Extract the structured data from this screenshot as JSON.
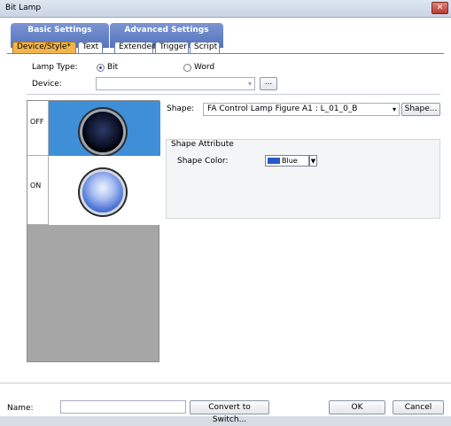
{
  "window": {
    "title": "Bit Lamp",
    "close_glyph": "✕"
  },
  "tabs": {
    "groups": [
      {
        "label": "Basic Settings"
      },
      {
        "label": "Advanced Settings"
      }
    ],
    "subtabs": [
      "Device/Style*",
      "Text",
      "Extended",
      "Trigger",
      "Script"
    ],
    "active_subtab": "Device/Style*"
  },
  "lamp_type": {
    "label": "Lamp Type:",
    "options": [
      {
        "label": "Bit",
        "checked": true
      },
      {
        "label": "Word",
        "checked": false
      }
    ]
  },
  "device": {
    "label": "Device:",
    "value": "",
    "browse_label": "..."
  },
  "states": [
    {
      "label": "OFF",
      "lamp": "dark-lamp"
    },
    {
      "label": "ON",
      "lamp": "lit-lamp"
    }
  ],
  "shape": {
    "label": "Shape:",
    "value": "FA Control Lamp Figure A1 : L_01_0_B",
    "button_label": "Shape..."
  },
  "shape_attribute": {
    "title": "Shape Attribute",
    "color_label": "Shape Color:",
    "color_value": "Blue",
    "color_hex": "#2657c9"
  },
  "footer": {
    "name_label": "Name:",
    "name_value": "",
    "convert_label": "Convert to Switch...",
    "ok_label": "OK",
    "cancel_label": "Cancel"
  },
  "colors": {
    "accent_tab": "#f2b54c",
    "tab_group": "#5573bd",
    "selected_cell": "#3f8fd8"
  }
}
